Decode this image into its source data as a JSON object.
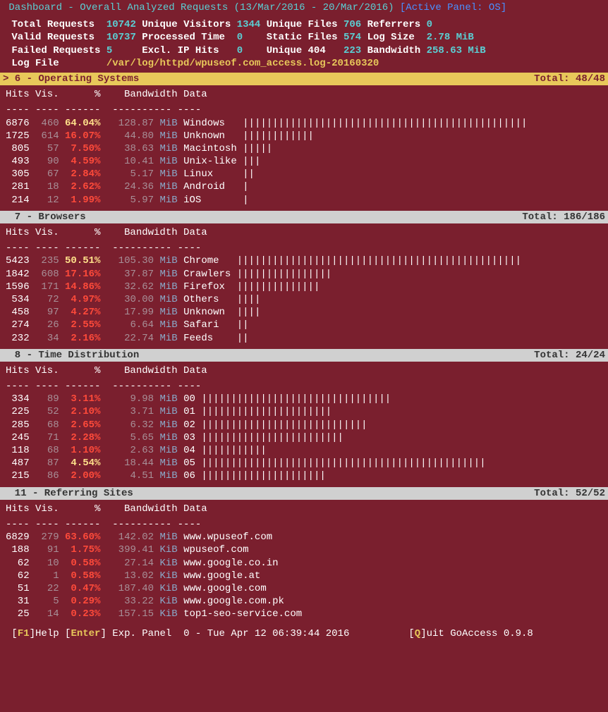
{
  "header": {
    "title": "Dashboard - Overall Analyzed Requests (13/Mar/2016 - 20/Mar/2016)",
    "active_panel": "[Active Panel: OS]"
  },
  "stats": {
    "total_requests_l": "Total Requests",
    "total_requests_v": "10742",
    "unique_visitors_l": "Unique Visitors",
    "unique_visitors_v": "1344",
    "unique_files_l": "Unique Files",
    "unique_files_v": "706",
    "referrers_l": "Referrers",
    "referrers_v": "0",
    "valid_requests_l": "Valid Requests",
    "valid_requests_v": "10737",
    "processed_time_l": "Processed Time",
    "processed_time_v": "0",
    "static_files_l": "Static Files",
    "static_files_v": "574",
    "log_size_l": "Log Size",
    "log_size_v": "2.78 MiB",
    "failed_requests_l": "Failed Requests",
    "failed_requests_v": "5",
    "excl_ip_hits_l": "Excl. IP Hits",
    "excl_ip_hits_v": "0",
    "unique_404_l": "Unique 404",
    "unique_404_v": "223",
    "bandwidth_l": "Bandwidth",
    "bandwidth_v": "258.63 MiB",
    "log_file_l": "Log File",
    "log_file_v": "/var/log/httpd/wpuseof.com_access.log-20160320"
  },
  "columns": "Hits Vis.      %    Bandwidth Data",
  "underlines": "---- ---- ------  ---------- ----",
  "panels": {
    "os": {
      "title": "> 6 - Operating Systems",
      "total": "Total: 48/48",
      "rows": [
        {
          "hits": "6876",
          "vis": "460",
          "pct": "64.04%",
          "bw": "128.87",
          "unit": "MiB",
          "data": "Windows",
          "bar": "||||||||||||||||||||||||||||||||||||||||||||||||",
          "top": true
        },
        {
          "hits": "1725",
          "vis": "614",
          "pct": "16.07%",
          "bw": "44.80",
          "unit": "MiB",
          "data": "Unknown",
          "bar": "||||||||||||"
        },
        {
          "hits": "805",
          "vis": "57",
          "pct": "7.50%",
          "bw": "38.63",
          "unit": "MiB",
          "data": "Macintosh",
          "bar": "|||||"
        },
        {
          "hits": "493",
          "vis": "90",
          "pct": "4.59%",
          "bw": "10.41",
          "unit": "MiB",
          "data": "Unix-like",
          "bar": "|||"
        },
        {
          "hits": "305",
          "vis": "67",
          "pct": "2.84%",
          "bw": "5.17",
          "unit": "MiB",
          "data": "Linux",
          "bar": "||"
        },
        {
          "hits": "281",
          "vis": "18",
          "pct": "2.62%",
          "bw": "24.36",
          "unit": "MiB",
          "data": "Android",
          "bar": "|"
        },
        {
          "hits": "214",
          "vis": "12",
          "pct": "1.99%",
          "bw": "5.97",
          "unit": "MiB",
          "data": "iOS",
          "bar": "|"
        }
      ]
    },
    "browsers": {
      "title": "  7 - Browsers",
      "total": "Total: 186/186",
      "rows": [
        {
          "hits": "5423",
          "vis": "235",
          "pct": "50.51%",
          "bw": "105.30",
          "unit": "MiB",
          "data": "Chrome",
          "bar": "||||||||||||||||||||||||||||||||||||||||||||||||",
          "top": true
        },
        {
          "hits": "1842",
          "vis": "608",
          "pct": "17.16%",
          "bw": "37.87",
          "unit": "MiB",
          "data": "Crawlers",
          "bar": "||||||||||||||||"
        },
        {
          "hits": "1596",
          "vis": "171",
          "pct": "14.86%",
          "bw": "32.62",
          "unit": "MiB",
          "data": "Firefox",
          "bar": "||||||||||||||"
        },
        {
          "hits": "534",
          "vis": "72",
          "pct": "4.97%",
          "bw": "30.00",
          "unit": "MiB",
          "data": "Others",
          "bar": "||||"
        },
        {
          "hits": "458",
          "vis": "97",
          "pct": "4.27%",
          "bw": "17.99",
          "unit": "MiB",
          "data": "Unknown",
          "bar": "||||"
        },
        {
          "hits": "274",
          "vis": "26",
          "pct": "2.55%",
          "bw": "6.64",
          "unit": "MiB",
          "data": "Safari",
          "bar": "||"
        },
        {
          "hits": "232",
          "vis": "34",
          "pct": "2.16%",
          "bw": "22.74",
          "unit": "MiB",
          "data": "Feeds",
          "bar": "||"
        }
      ]
    },
    "time": {
      "title": "  8 - Time Distribution",
      "total": "Total: 24/24",
      "rows": [
        {
          "hits": "334",
          "vis": "89",
          "pct": "3.11%",
          "bw": "9.98",
          "unit": "MiB",
          "data": "00",
          "bar": "||||||||||||||||||||||||||||||||"
        },
        {
          "hits": "225",
          "vis": "52",
          "pct": "2.10%",
          "bw": "3.71",
          "unit": "MiB",
          "data": "01",
          "bar": "||||||||||||||||||||||"
        },
        {
          "hits": "285",
          "vis": "68",
          "pct": "2.65%",
          "bw": "6.32",
          "unit": "MiB",
          "data": "02",
          "bar": "||||||||||||||||||||||||||||"
        },
        {
          "hits": "245",
          "vis": "71",
          "pct": "2.28%",
          "bw": "5.65",
          "unit": "MiB",
          "data": "03",
          "bar": "||||||||||||||||||||||||"
        },
        {
          "hits": "118",
          "vis": "68",
          "pct": "1.10%",
          "bw": "2.63",
          "unit": "MiB",
          "data": "04",
          "bar": "|||||||||||"
        },
        {
          "hits": "487",
          "vis": "87",
          "pct": "4.54%",
          "bw": "18.44",
          "unit": "MiB",
          "data": "05",
          "bar": "||||||||||||||||||||||||||||||||||||||||||||||||",
          "top": true
        },
        {
          "hits": "215",
          "vis": "86",
          "pct": "2.00%",
          "bw": "4.51",
          "unit": "MiB",
          "data": "06",
          "bar": "|||||||||||||||||||||"
        }
      ]
    },
    "referring": {
      "title": "  11 - Referring Sites",
      "total": "Total: 52/52",
      "rows": [
        {
          "hits": "6829",
          "vis": "279",
          "pct": "63.60%",
          "bw": "142.02",
          "unit": "MiB",
          "data": "www.wpuseof.com",
          "bar": ""
        },
        {
          "hits": "188",
          "vis": "91",
          "pct": "1.75%",
          "bw": "399.41",
          "unit": "KiB",
          "data": "wpuseof.com",
          "bar": ""
        },
        {
          "hits": "62",
          "vis": "10",
          "pct": "0.58%",
          "bw": "27.14",
          "unit": "KiB",
          "data": "www.google.co.in",
          "bar": ""
        },
        {
          "hits": "62",
          "vis": "1",
          "pct": "0.58%",
          "bw": "13.02",
          "unit": "KiB",
          "data": "www.google.at",
          "bar": ""
        },
        {
          "hits": "51",
          "vis": "22",
          "pct": "0.47%",
          "bw": "187.40",
          "unit": "KiB",
          "data": "www.google.com",
          "bar": ""
        },
        {
          "hits": "31",
          "vis": "5",
          "pct": "0.29%",
          "bw": "33.22",
          "unit": "KiB",
          "data": "www.google.com.pk",
          "bar": ""
        },
        {
          "hits": "25",
          "vis": "14",
          "pct": "0.23%",
          "bw": "157.15",
          "unit": "KiB",
          "data": "top1-seo-service.com",
          "bar": ""
        }
      ]
    }
  },
  "footer": {
    "help_key": "F1",
    "help_txt": "Help",
    "enter_key": "Enter",
    "enter_txt": " Exp. Panel",
    "status": "0 - Tue Apr 12 06:39:44 2016",
    "quit_key": "Q",
    "quit_txt": "uit",
    "app": "GoAccess 0.9.8"
  }
}
